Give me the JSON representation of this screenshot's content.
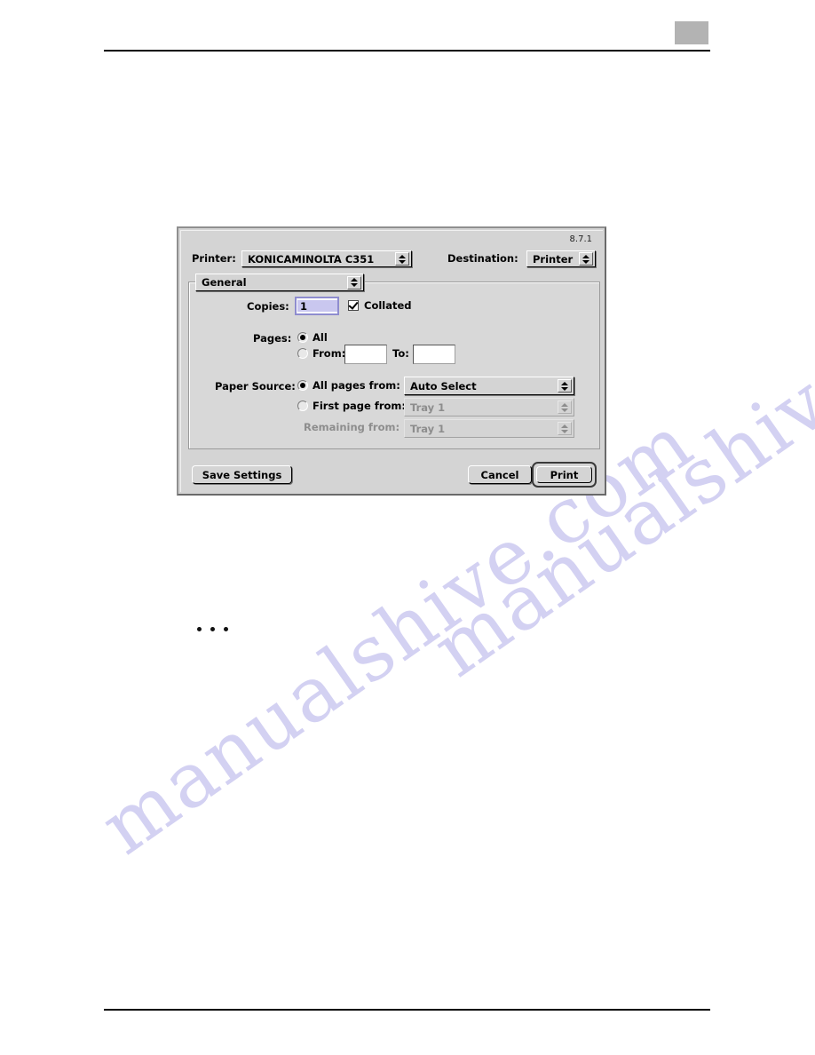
{
  "page": {
    "ellipsis": "• • •"
  },
  "watermark": {
    "line1": "manualshive.com",
    "line2": "manualshive.com"
  },
  "dialog": {
    "version": "8.7.1",
    "printer": {
      "label": "Printer:",
      "value": "KONICAMINOLTA C351"
    },
    "destination": {
      "label": "Destination:",
      "value": "Printer"
    },
    "pane_menu": {
      "value": "General"
    },
    "copies": {
      "label": "Copies:",
      "value": "1",
      "collated_label": "Collated",
      "collated_checked": true
    },
    "pages": {
      "label": "Pages:",
      "all_label": "All",
      "all_selected": true,
      "from_label": "From:",
      "from_value": "",
      "to_label": "To:",
      "to_value": "",
      "range_selected": false
    },
    "paper_source": {
      "label": "Paper Source:",
      "all_pages_label": "All pages from:",
      "all_pages_selected": true,
      "all_pages_value": "Auto Select",
      "first_page_label": "First page from:",
      "first_page_selected": false,
      "first_page_value": "Tray 1",
      "remaining_label": "Remaining from:",
      "remaining_value": "Tray 1"
    },
    "buttons": {
      "save_settings": "Save Settings",
      "cancel": "Cancel",
      "print": "Print"
    }
  }
}
